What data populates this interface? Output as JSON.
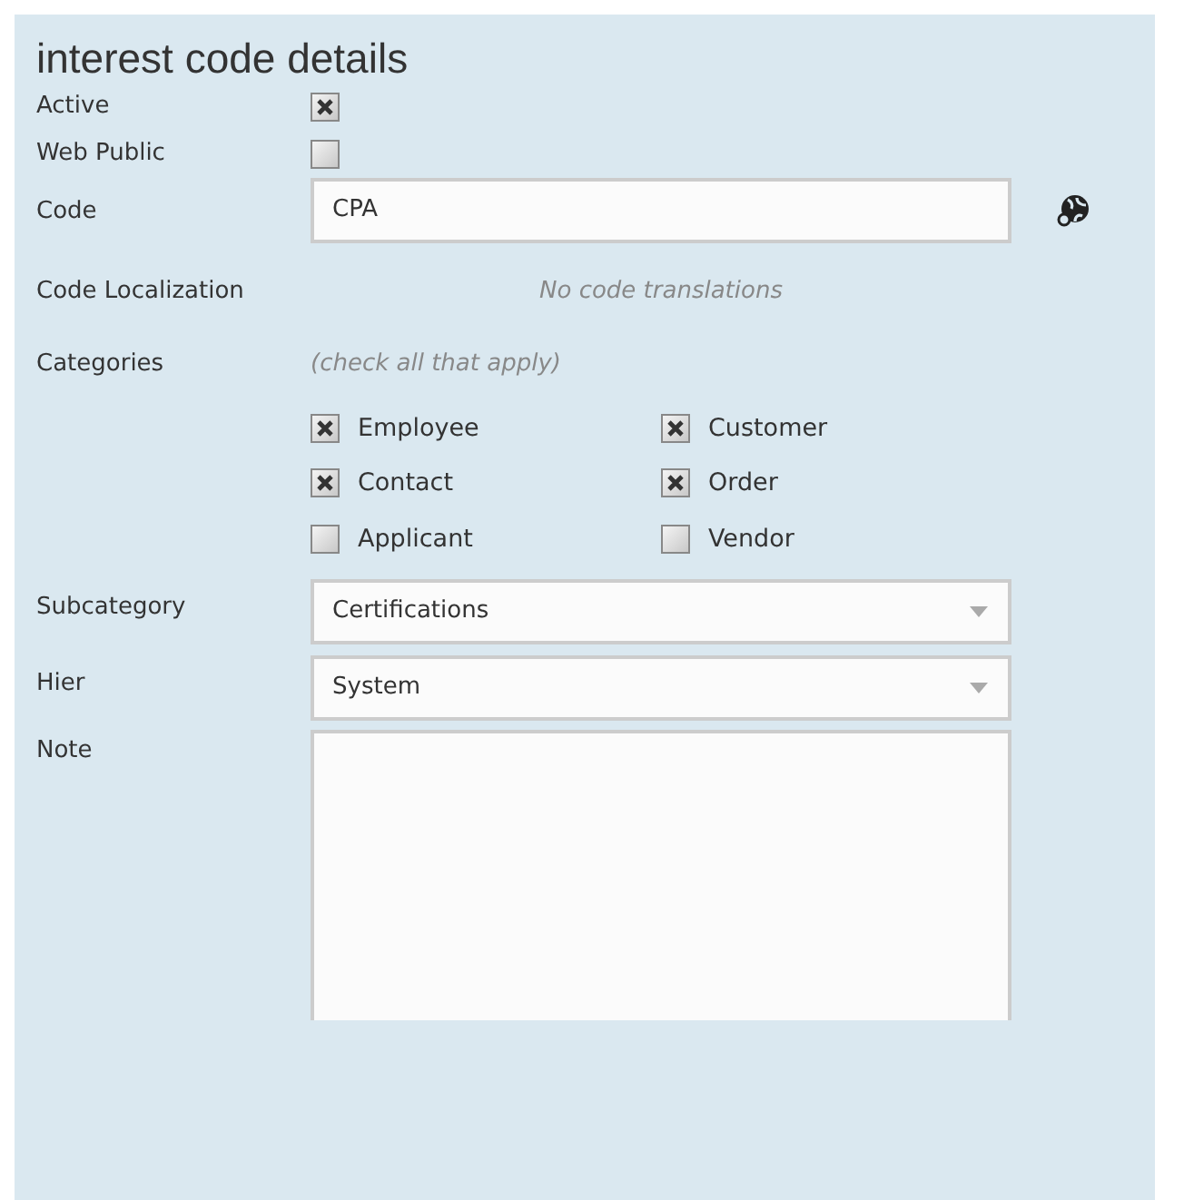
{
  "title": "interest code details",
  "active": {
    "label": "Active",
    "checked": true
  },
  "web_public": {
    "label": "Web Public",
    "checked": false
  },
  "code": {
    "label": "Code",
    "value": "CPA"
  },
  "code_localization": {
    "label": "Code Localization",
    "message": "No code translations"
  },
  "categories": {
    "label": "Categories",
    "hint": "(check all that apply)",
    "options": [
      {
        "label": "Employee",
        "checked": true
      },
      {
        "label": "Customer",
        "checked": true
      },
      {
        "label": "Contact",
        "checked": true
      },
      {
        "label": "Order",
        "checked": true
      },
      {
        "label": "Applicant",
        "checked": false
      },
      {
        "label": "Vendor",
        "checked": false
      }
    ]
  },
  "subcategory": {
    "label": "Subcategory",
    "value": "Certifications"
  },
  "hier": {
    "label": "Hier",
    "value": "System"
  },
  "note": {
    "label": "Note"
  }
}
